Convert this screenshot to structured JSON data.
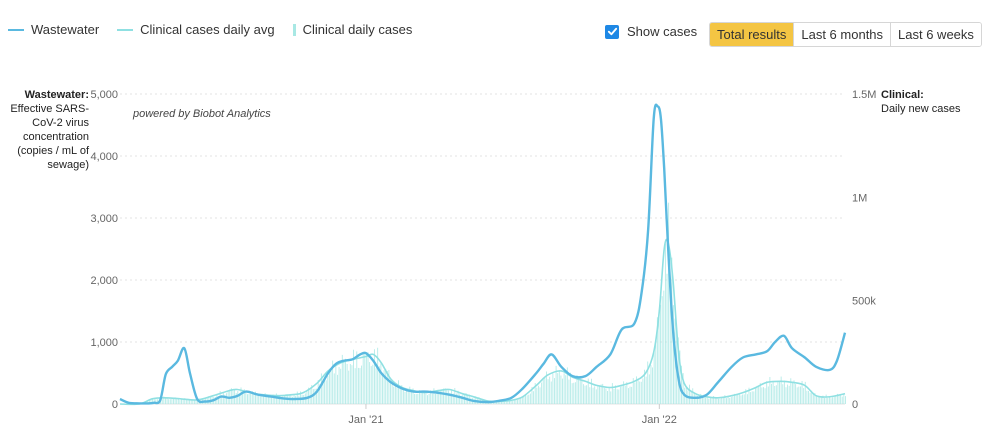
{
  "legend": {
    "wastewater": "Wastewater",
    "clinical_avg": "Clinical cases daily avg",
    "clinical_daily": "Clinical daily cases"
  },
  "controls": {
    "show_cases_label": "Show cases",
    "show_cases_checked": true,
    "ranges": [
      "Total results",
      "Last 6 months",
      "Last 6 weeks"
    ],
    "active_range": 0
  },
  "axis_left": {
    "title_bold": "Wastewater:",
    "title_rest": "Effective SARS-CoV-2 virus concentration (copies / mL of sewage)"
  },
  "axis_right": {
    "title_bold": "Clinical:",
    "title_rest": "Daily new cases"
  },
  "colors": {
    "wastewater": "#5ab9e0",
    "clinical_avg": "#8fe0e2",
    "clinical_daily": "#a8e8e4",
    "accent": "#f4c543",
    "checkbox": "#1e88e5"
  },
  "chart_data": {
    "type": "line",
    "annotation": "powered by Biobot Analytics",
    "x_ticks": [
      {
        "date": "2021-01-01",
        "label": "Jan '21"
      },
      {
        "date": "2022-01-01",
        "label": "Jan '22"
      }
    ],
    "xlim": [
      "2020-03-01",
      "2022-08-20"
    ],
    "y_left": {
      "ylim": [
        0,
        5000
      ],
      "ticks": [
        0,
        1000,
        2000,
        3000,
        4000,
        5000
      ],
      "tick_labels": [
        "0",
        "1,000",
        "2,000",
        "3,000",
        "4,000",
        "5,000"
      ]
    },
    "y_right": {
      "ylim": [
        0,
        1500000
      ],
      "ticks": [
        0,
        500000,
        1000000,
        1500000
      ],
      "tick_labels": [
        "0",
        "500k",
        "1M",
        "1.5M"
      ]
    },
    "grid": true,
    "series": [
      {
        "name": "Wastewater",
        "axis": "left",
        "x": [
          "2020-03-01",
          "2020-03-12",
          "2020-03-25",
          "2020-04-05",
          "2020-04-12",
          "2020-04-20",
          "2020-04-27",
          "2020-05-05",
          "2020-05-12",
          "2020-05-20",
          "2020-05-27",
          "2020-06-05",
          "2020-06-15",
          "2020-06-25",
          "2020-07-05",
          "2020-07-15",
          "2020-07-25",
          "2020-08-05",
          "2020-08-20",
          "2020-09-05",
          "2020-09-20",
          "2020-10-05",
          "2020-10-20",
          "2020-11-01",
          "2020-11-15",
          "2020-11-25",
          "2020-12-05",
          "2020-12-15",
          "2020-12-25",
          "2021-01-01",
          "2021-01-10",
          "2021-01-20",
          "2021-02-01",
          "2021-02-15",
          "2021-03-01",
          "2021-03-15",
          "2021-04-01",
          "2021-04-15",
          "2021-05-01",
          "2021-05-15",
          "2021-06-01",
          "2021-06-15",
          "2021-07-01",
          "2021-07-15",
          "2021-08-01",
          "2021-08-10",
          "2021-08-20",
          "2021-09-01",
          "2021-09-15",
          "2021-10-01",
          "2021-10-15",
          "2021-11-01",
          "2021-11-15",
          "2021-12-01",
          "2021-12-10",
          "2021-12-18",
          "2021-12-25",
          "2021-12-30",
          "2022-01-03",
          "2022-01-07",
          "2022-01-12",
          "2022-01-18",
          "2022-01-25",
          "2022-02-01",
          "2022-02-15",
          "2022-03-01",
          "2022-03-15",
          "2022-04-01",
          "2022-04-15",
          "2022-05-01",
          "2022-05-15",
          "2022-05-25",
          "2022-06-05",
          "2022-06-15",
          "2022-07-01",
          "2022-07-15",
          "2022-08-01",
          "2022-08-10",
          "2022-08-20"
        ],
        "y": [
          80,
          20,
          10,
          10,
          20,
          60,
          480,
          600,
          700,
          900,
          500,
          80,
          40,
          60,
          120,
          100,
          130,
          200,
          150,
          120,
          90,
          80,
          100,
          200,
          500,
          650,
          700,
          720,
          800,
          820,
          700,
          500,
          350,
          250,
          200,
          200,
          180,
          150,
          100,
          50,
          30,
          50,
          100,
          250,
          500,
          650,
          800,
          600,
          450,
          450,
          600,
          800,
          1200,
          1300,
          1800,
          2800,
          4600,
          4800,
          4600,
          3800,
          2500,
          1200,
          400,
          150,
          100,
          150,
          350,
          600,
          750,
          800,
          850,
          1000,
          1100,
          900,
          750,
          600,
          550,
          700,
          1150
        ]
      },
      {
        "name": "Clinical cases daily avg",
        "axis": "right",
        "x": [
          "2020-03-01",
          "2020-03-25",
          "2020-04-10",
          "2020-04-25",
          "2020-05-15",
          "2020-06-05",
          "2020-06-25",
          "2020-07-15",
          "2020-07-25",
          "2020-08-10",
          "2020-08-25",
          "2020-09-15",
          "2020-10-01",
          "2020-10-15",
          "2020-11-01",
          "2020-11-15",
          "2020-12-01",
          "2020-12-15",
          "2021-01-01",
          "2021-01-10",
          "2021-01-20",
          "2021-02-01",
          "2021-02-15",
          "2021-03-01",
          "2021-03-15",
          "2021-04-01",
          "2021-04-15",
          "2021-05-01",
          "2021-05-15",
          "2021-06-01",
          "2021-06-15",
          "2021-07-01",
          "2021-07-15",
          "2021-08-01",
          "2021-08-15",
          "2021-09-01",
          "2021-09-15",
          "2021-10-01",
          "2021-10-15",
          "2021-11-01",
          "2021-11-15",
          "2021-12-01",
          "2021-12-15",
          "2021-12-25",
          "2022-01-01",
          "2022-01-07",
          "2022-01-12",
          "2022-01-18",
          "2022-01-25",
          "2022-02-01",
          "2022-02-15",
          "2022-03-01",
          "2022-03-15",
          "2022-04-01",
          "2022-04-15",
          "2022-05-01",
          "2022-05-15",
          "2022-06-01",
          "2022-06-15",
          "2022-07-01",
          "2022-07-15",
          "2022-08-01",
          "2022-08-20"
        ],
        "y": [
          0,
          0,
          25000,
          30000,
          25000,
          20000,
          40000,
          65000,
          70000,
          55000,
          45000,
          40000,
          45000,
          55000,
          100000,
          160000,
          200000,
          215000,
          230000,
          240000,
          200000,
          120000,
          80000,
          65000,
          55000,
          65000,
          70000,
          50000,
          35000,
          15000,
          12000,
          18000,
          35000,
          90000,
          140000,
          160000,
          130000,
          110000,
          90000,
          80000,
          90000,
          110000,
          150000,
          250000,
          450000,
          750000,
          780000,
          600000,
          250000,
          100000,
          50000,
          35000,
          30000,
          40000,
          55000,
          80000,
          105000,
          110000,
          105000,
          90000,
          40000,
          35000,
          50000
        ]
      },
      {
        "name": "Clinical daily cases",
        "axis": "right",
        "type": "bar",
        "x": [
          "2020-03-01",
          "2020-03-25",
          "2020-04-10",
          "2020-04-25",
          "2020-05-15",
          "2020-06-05",
          "2020-06-25",
          "2020-07-15",
          "2020-07-25",
          "2020-08-10",
          "2020-08-25",
          "2020-09-15",
          "2020-10-01",
          "2020-10-15",
          "2020-11-01",
          "2020-11-15",
          "2020-12-01",
          "2020-12-15",
          "2021-01-01",
          "2021-01-10",
          "2021-01-20",
          "2021-02-01",
          "2021-02-15",
          "2021-03-01",
          "2021-03-15",
          "2021-04-01",
          "2021-04-15",
          "2021-05-01",
          "2021-05-15",
          "2021-06-01",
          "2021-06-15",
          "2021-07-01",
          "2021-07-15",
          "2021-08-01",
          "2021-08-15",
          "2021-09-01",
          "2021-09-15",
          "2021-10-01",
          "2021-10-15",
          "2021-11-01",
          "2021-11-15",
          "2021-12-01",
          "2021-12-15",
          "2021-12-25",
          "2022-01-01",
          "2022-01-07",
          "2022-01-12",
          "2022-01-18",
          "2022-01-25",
          "2022-02-01",
          "2022-02-15",
          "2022-03-01",
          "2022-03-15",
          "2022-04-01",
          "2022-04-15",
          "2022-05-01",
          "2022-05-15",
          "2022-06-01",
          "2022-06-15",
          "2022-07-01",
          "2022-07-15",
          "2022-08-01",
          "2022-08-20"
        ],
        "y": [
          0,
          0,
          25000,
          30000,
          25000,
          20000,
          40000,
          65000,
          70000,
          55000,
          45000,
          40000,
          45000,
          55000,
          100000,
          160000,
          200000,
          215000,
          230000,
          240000,
          200000,
          120000,
          80000,
          65000,
          55000,
          65000,
          70000,
          50000,
          35000,
          15000,
          12000,
          18000,
          35000,
          90000,
          140000,
          160000,
          130000,
          110000,
          90000,
          80000,
          90000,
          110000,
          150000,
          250000,
          450000,
          750000,
          780000,
          600000,
          250000,
          100000,
          50000,
          35000,
          30000,
          40000,
          55000,
          80000,
          105000,
          110000,
          105000,
          90000,
          40000,
          35000,
          50000
        ]
      }
    ]
  }
}
